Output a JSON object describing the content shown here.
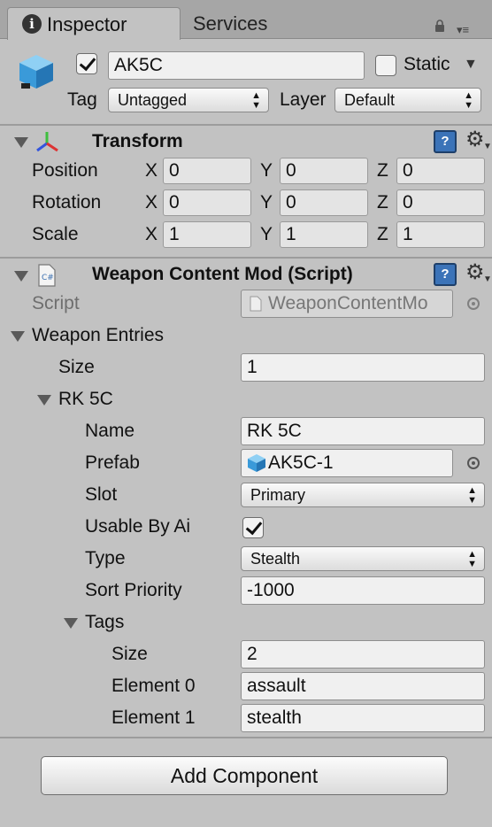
{
  "tabs": {
    "inspector": "Inspector",
    "services": "Services"
  },
  "object": {
    "name": "AK5C",
    "static_label": "Static",
    "tag_label": "Tag",
    "tag_value": "Untagged",
    "layer_label": "Layer",
    "layer_value": "Default"
  },
  "transform": {
    "title": "Transform",
    "rows": [
      {
        "label": "Position",
        "x": "0",
        "y": "0",
        "z": "0"
      },
      {
        "label": "Rotation",
        "x": "0",
        "y": "0",
        "z": "0"
      },
      {
        "label": "Scale",
        "x": "1",
        "y": "1",
        "z": "1"
      }
    ],
    "axes": {
      "x": "X",
      "y": "Y",
      "z": "Z"
    }
  },
  "script_component": {
    "title": "Weapon Content Mod (Script)",
    "script_label": "Script",
    "script_value": "WeaponContentMo",
    "entries_label": "Weapon Entries",
    "size_label": "Size",
    "size_value": "1",
    "entry_label": "RK 5C",
    "name_label": "Name",
    "name_value": "RK 5C",
    "prefab_label": "Prefab",
    "prefab_value": "AK5C-1",
    "slot_label": "Slot",
    "slot_value": "Primary",
    "usable_label": "Usable By Ai",
    "usable_checked": true,
    "type_label": "Type",
    "type_value": "Stealth",
    "sort_label": "Sort Priority",
    "sort_value": "-1000",
    "tags_label": "Tags",
    "tags_size_label": "Size",
    "tags_size_value": "2",
    "element0_label": "Element 0",
    "element0_value": "assault",
    "element1_label": "Element 1",
    "element1_value": "stealth"
  },
  "add_component": "Add Component",
  "colors": {
    "panel": "#c2c2c2",
    "tabbar": "#a6a6a6",
    "help_blue": "#3b73b8"
  }
}
